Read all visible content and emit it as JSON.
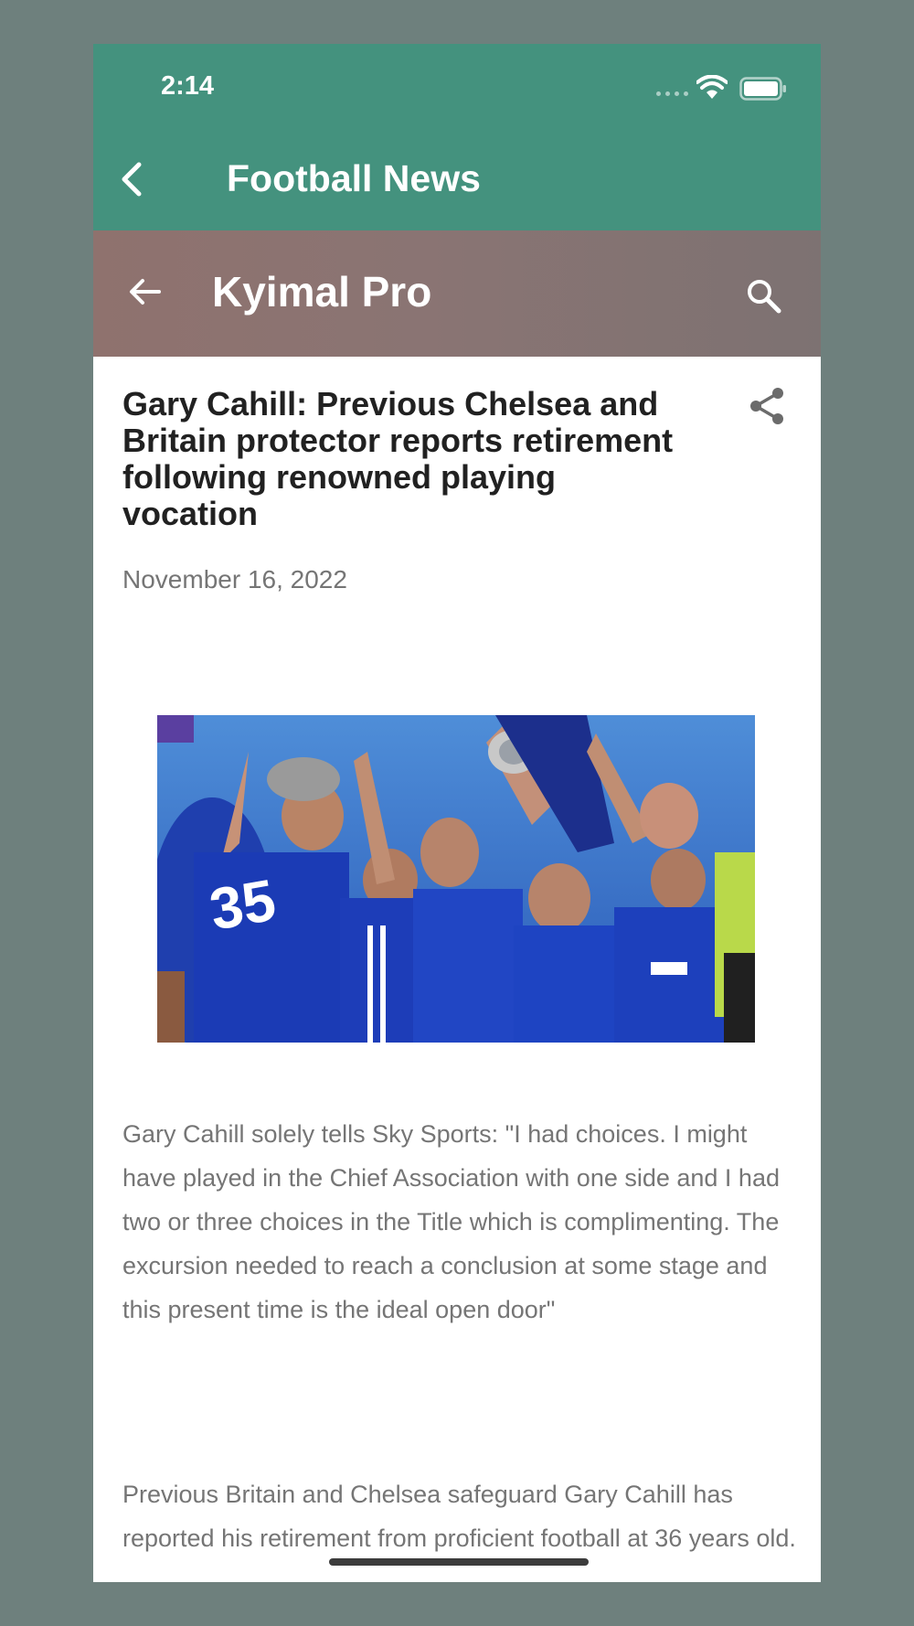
{
  "status_bar": {
    "time": "2:14",
    "signal_icon": "signal-dots-icon",
    "wifi_icon": "wifi-icon",
    "battery_icon": "battery-icon"
  },
  "app_bar": {
    "title": "Football News",
    "back_icon": "chevron-left-icon",
    "background": "#44927e"
  },
  "site_header": {
    "title": "Kyimal Pro",
    "back_icon": "arrow-left-icon",
    "search_icon": "search-icon"
  },
  "article": {
    "title": "Gary Cahill: Previous Chelsea and Britain protector reports retirement following renowned playing vocation",
    "date": "November 16, 2022",
    "share_icon": "share-icon",
    "image_alt": "Chelsea players celebrating with the Premier League trophy",
    "paragraphs": [
      "Gary Cahill solely tells Sky Sports: \"I had choices. I might have played in the Chief Association with one side and I had two or three choices in the Title which is complimenting. The excursion needed to reach a conclusion at some stage and this present time is the ideal open door\"",
      "Previous Britain and Chelsea safeguard Gary Cahill has reported his retirement from proficient football at 36 years old."
    ]
  },
  "colors": {
    "accent": "#44927e",
    "outer_background": "#6e807d",
    "body_text": "#757575",
    "title_text": "#212121"
  }
}
